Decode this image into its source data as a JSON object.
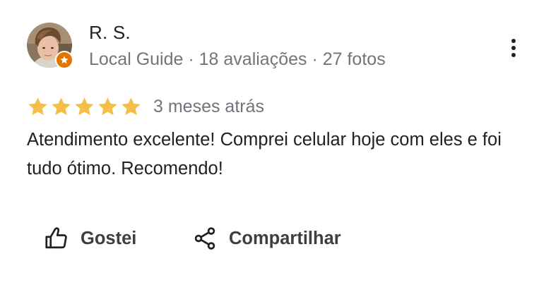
{
  "reviewer": {
    "name": "R. S.",
    "meta": "Local Guide · 18 avaliações · 27 fotos",
    "avatar_icon": "avatar-photo",
    "badge_icon": "local-guide-star-badge"
  },
  "review": {
    "rating": 5,
    "max_rating": 5,
    "date": "3 meses atrás",
    "text": "Atendimento excelente! Comprei celular hoje com eles e foi tudo ótimo. Recomendo!"
  },
  "actions": {
    "like_label": "Gostei",
    "share_label": "Compartilhar",
    "like_icon": "thumbs-up-icon",
    "share_icon": "share-icon",
    "more_icon": "more-vert-icon"
  },
  "colors": {
    "star": "#f5be45",
    "badge": "#e37400",
    "text_primary": "#202124",
    "text_secondary": "#70757a",
    "action_text": "#3c4043"
  }
}
